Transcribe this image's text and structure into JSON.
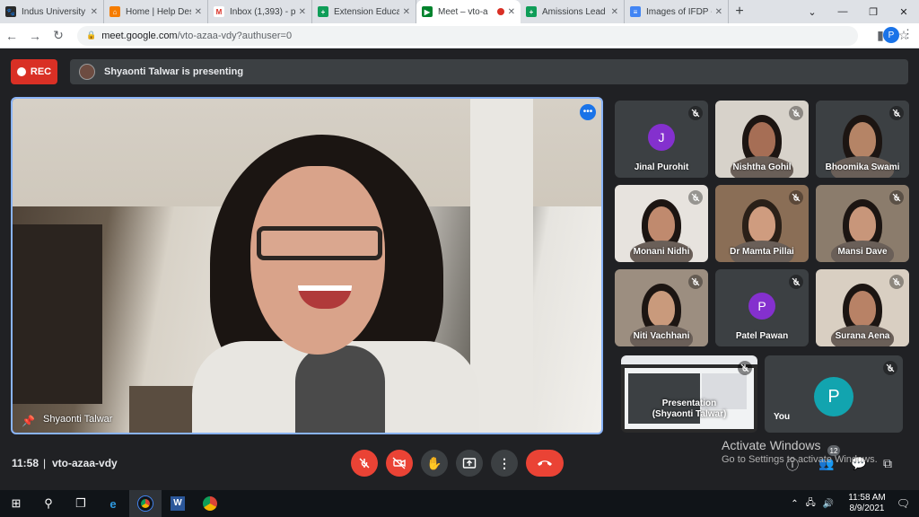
{
  "browser": {
    "tabs": [
      {
        "title": "Indus University",
        "favicon_color": "#2b2b2b",
        "favicon_glyph": "🐾"
      },
      {
        "title": "Home | Help Desk",
        "favicon_color": "#f57c00",
        "favicon_glyph": "⌂"
      },
      {
        "title": "Inbox (1,393) - p",
        "favicon_color": "#ffffff",
        "favicon_glyph": "M"
      },
      {
        "title": "Extension Educat",
        "favicon_color": "#0f9d58",
        "favicon_glyph": "+"
      },
      {
        "title": "Meet – vto-a",
        "favicon_color": "#00832d",
        "favicon_glyph": "▶",
        "active": true,
        "recording": true
      },
      {
        "title": "Amissions Lead",
        "favicon_color": "#0f9d58",
        "favicon_glyph": "+"
      },
      {
        "title": "Images of IFDP -",
        "favicon_color": "#4285f4",
        "favicon_glyph": "≡"
      }
    ],
    "url_host": "meet.google.com",
    "url_path": "/vto-azaa-vdy?authuser=0",
    "profile_initial": "P"
  },
  "meet": {
    "rec_label": "REC",
    "presenting_text": "Shyaonti Talwar is presenting",
    "main_speaker_name": "Shyaonti Talwar",
    "participants": [
      {
        "name": "Jinal Purohit",
        "type": "avatar",
        "initial": "J",
        "color": "#8430ce"
      },
      {
        "name": "Nishtha Gohil",
        "type": "video",
        "bg": "#d7d2ca",
        "skin": "#a66e55",
        "hair": "#1c1512"
      },
      {
        "name": "Bhoomika Swami",
        "type": "video",
        "bg": "#3c4043",
        "skin": "#b58466",
        "hair": "#1c1512"
      },
      {
        "name": "Monani Nidhi",
        "type": "video",
        "bg": "#e7e3de",
        "skin": "#c08a6e",
        "hair": "#1c1512"
      },
      {
        "name": "Dr Mamta Pillai",
        "type": "video",
        "bg": "#8a6e56",
        "skin": "#cf9c7f",
        "hair": "#2a2018"
      },
      {
        "name": "Mansi Dave",
        "type": "video",
        "bg": "#8b7c6c",
        "skin": "#c8967a",
        "hair": "#1c1512"
      },
      {
        "name": "Niti Vachhani",
        "type": "video",
        "bg": "#9c8e80",
        "skin": "#c99a7c",
        "hair": "#1c1512"
      },
      {
        "name": "Patel Pawan",
        "type": "avatar",
        "initial": "P",
        "color": "#8430ce"
      },
      {
        "name": "Surana Aena",
        "type": "video",
        "bg": "#d9cfc2",
        "skin": "#b88266",
        "hair": "#1c1512"
      }
    ],
    "presentation_tile": {
      "line1": "Presentation",
      "line2": "(Shyaonti Talwar)"
    },
    "self_tile": {
      "name": "You",
      "initial": "P",
      "color": "#12a4af"
    },
    "time": "11:58",
    "meeting_code": "vto-azaa-vdy",
    "people_count": "12"
  },
  "windows": {
    "activate_title": "Activate Windows",
    "activate_sub": "Go to Settings to activate Windows.",
    "clock_time": "11:58 AM",
    "clock_date": "8/9/2021"
  }
}
